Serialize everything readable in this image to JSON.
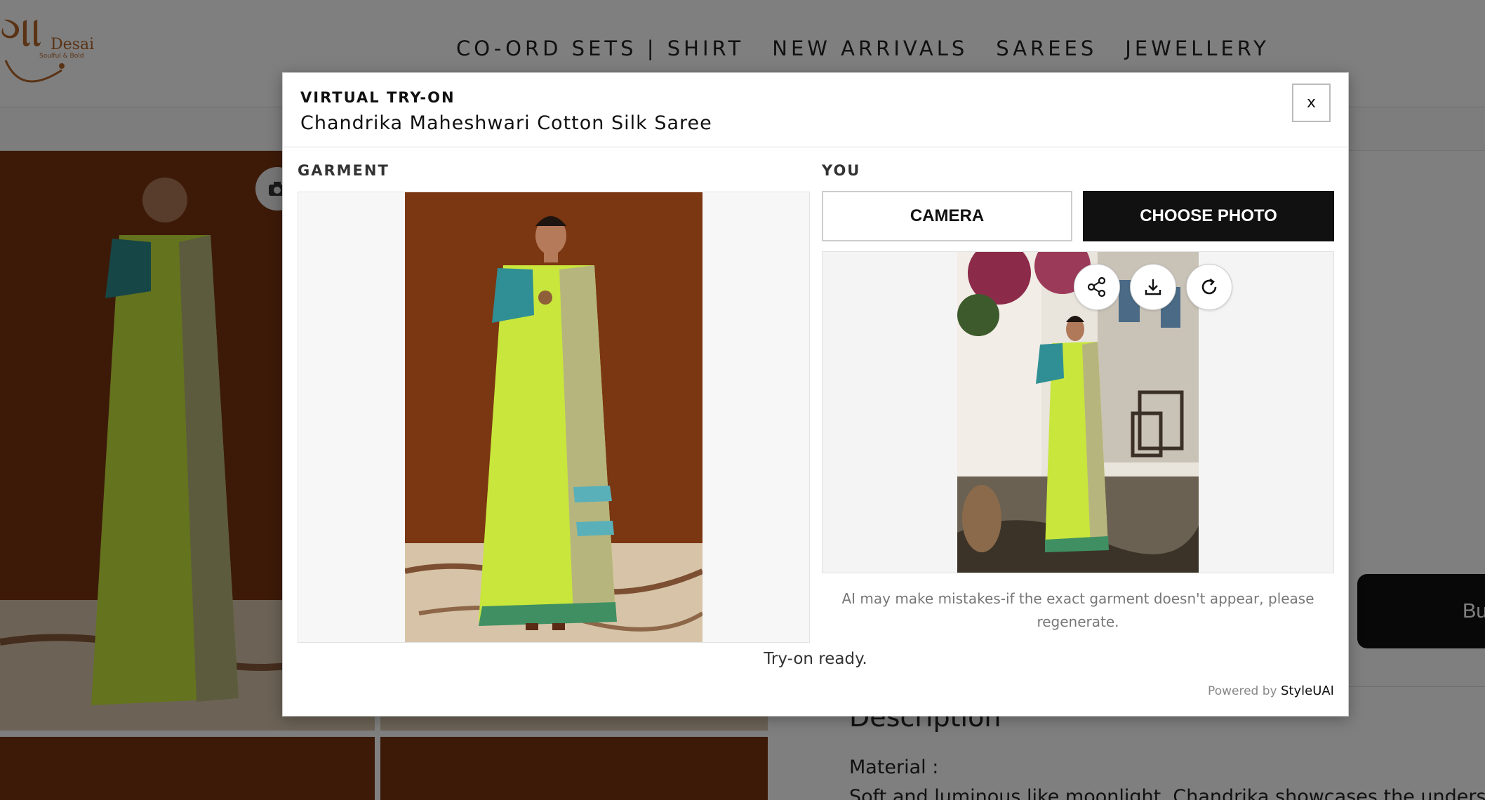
{
  "brand": {
    "logo_script": "ગા",
    "logo_name": "Desai",
    "logo_tagline": "Soulful & Bold"
  },
  "nav": {
    "items": [
      "CO-ORD SETS | SHIRT",
      "NEW ARRIVALS",
      "SAREES",
      "JEWELLERY"
    ]
  },
  "product_page": {
    "buy_label": "Bu",
    "description_title": "Description",
    "material_label": "Material :",
    "description_text": "Soft and luminous like moonlight, Chandrika showcases the understated"
  },
  "modal": {
    "kicker": "VIRTUAL TRY-ON",
    "title": "Chandrika Maheshwari Cotton Silk Saree",
    "close_label": "x",
    "garment_label": "GARMENT",
    "you_label": "YOU",
    "camera_label": "CAMERA",
    "choose_photo_label": "CHOOSE PHOTO",
    "disclaimer": "AI may make mistakes-if the exact garment doesn't appear, please regenerate.",
    "status": "Try-on ready.",
    "powered_by": "Powered by",
    "powered_brand": "StyleUAI",
    "actions": {
      "share": "share-icon",
      "download": "download-icon",
      "regenerate": "refresh-icon"
    }
  },
  "colors": {
    "accent": "#111111",
    "logo": "#b5662b",
    "saree": "#c8e63c"
  }
}
